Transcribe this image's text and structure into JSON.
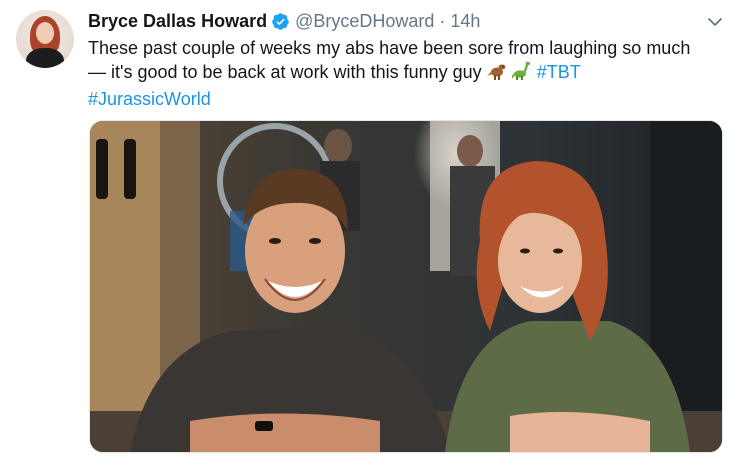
{
  "tweet": {
    "author_name": "Bryce Dallas Howard",
    "handle": "@BryceDHoward",
    "separator": "·",
    "time": "14h",
    "text_line_1": "These past couple of weeks my abs have been sore from laughing so much",
    "text_line_2": "— it's good to be back at work with this funny guy",
    "emojis": [
      "t-rex-emoji",
      "sauropod-emoji"
    ],
    "hashtag_1": "#TBT",
    "hashtag_2": "#JurassicWorld",
    "verified": true
  },
  "icons": {
    "verified": "verified-badge-icon",
    "menu": "chevron-down-icon"
  },
  "colors": {
    "link": "#1b95e0",
    "secondary_text": "#657786",
    "primary_text": "#14171a",
    "verified_badge": "#1da1f2"
  }
}
